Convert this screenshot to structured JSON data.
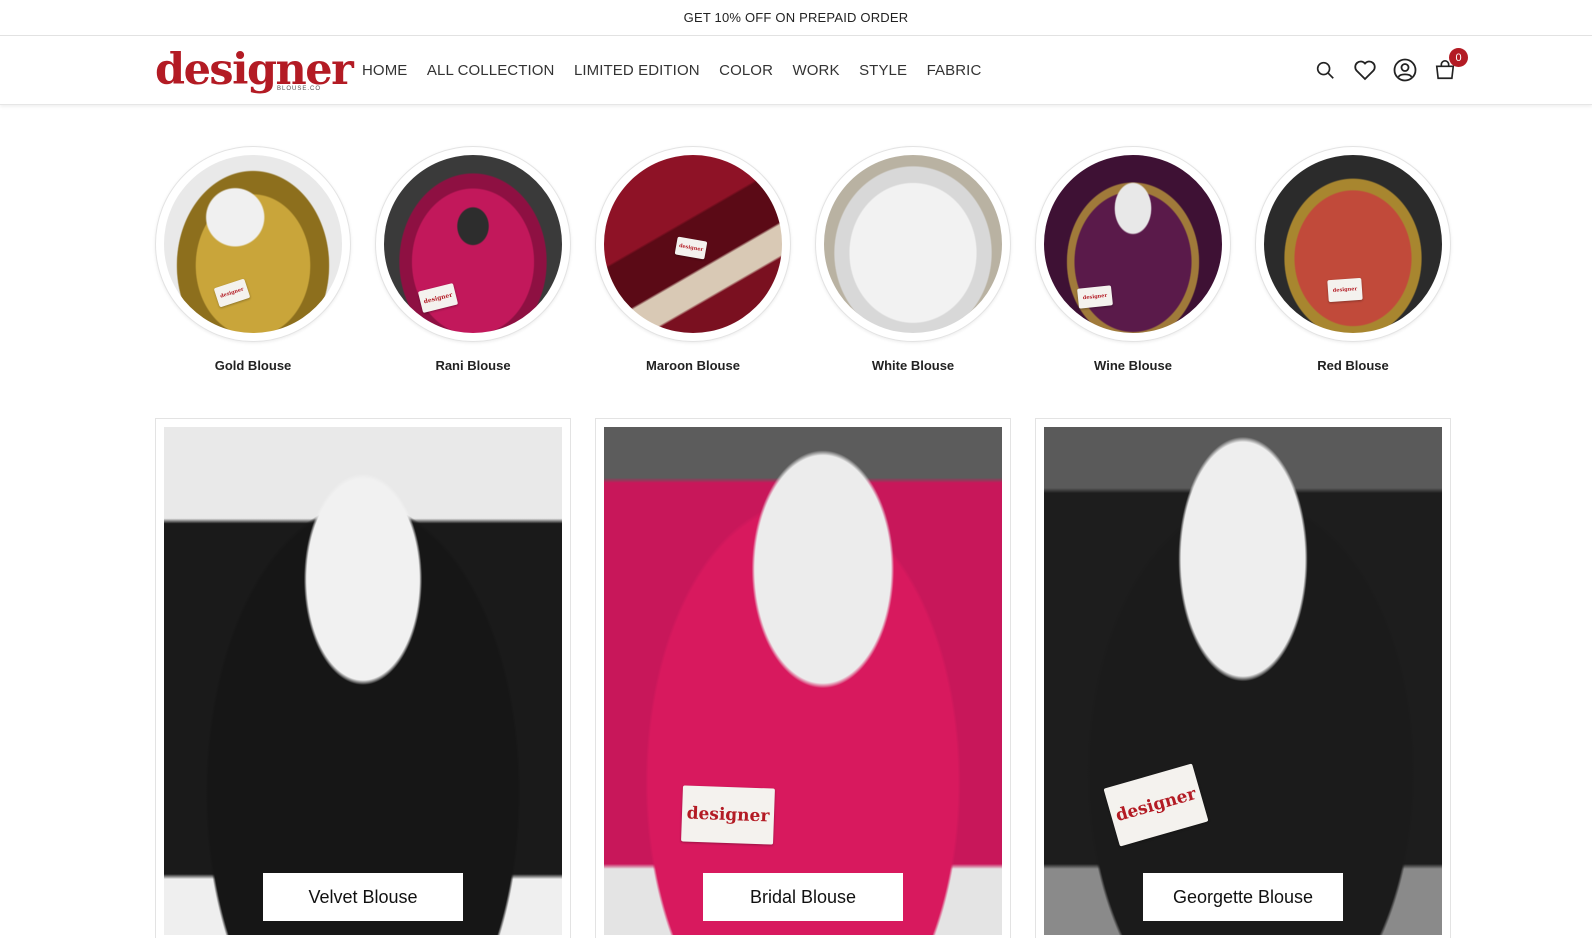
{
  "announcement": "GET 10% OFF ON PREPAID ORDER",
  "brand": {
    "name": "designer",
    "subtitle": "BLOUSE.CO",
    "color": "#b31b24"
  },
  "nav": [
    "HOME",
    "ALL COLLECTION",
    "LIMITED EDITION",
    "COLOR",
    "WORK",
    "STYLE",
    "FABRIC"
  ],
  "header_icons": [
    "search-icon",
    "heart-icon",
    "user-icon",
    "cart-icon"
  ],
  "cart_count": "0",
  "color_categories": [
    {
      "label": "Gold Blouse",
      "color": "#b8962e"
    },
    {
      "label": "Rani Blouse",
      "color": "#c2185b"
    },
    {
      "label": "Maroon Blouse",
      "color": "#7a1020"
    },
    {
      "label": "White Blouse",
      "color": "#e8e8e8"
    },
    {
      "label": "Wine Blouse",
      "color": "#5a1a4a"
    },
    {
      "label": "Red Blouse",
      "color": "#b5342a"
    }
  ],
  "fabric_categories": [
    {
      "label": "Velvet Blouse",
      "color": "#141414"
    },
    {
      "label": "Bridal Blouse",
      "color": "#d8195e"
    },
    {
      "label": "Georgette Blouse",
      "color": "#1a1a1a"
    }
  ],
  "tag_text": "designer"
}
